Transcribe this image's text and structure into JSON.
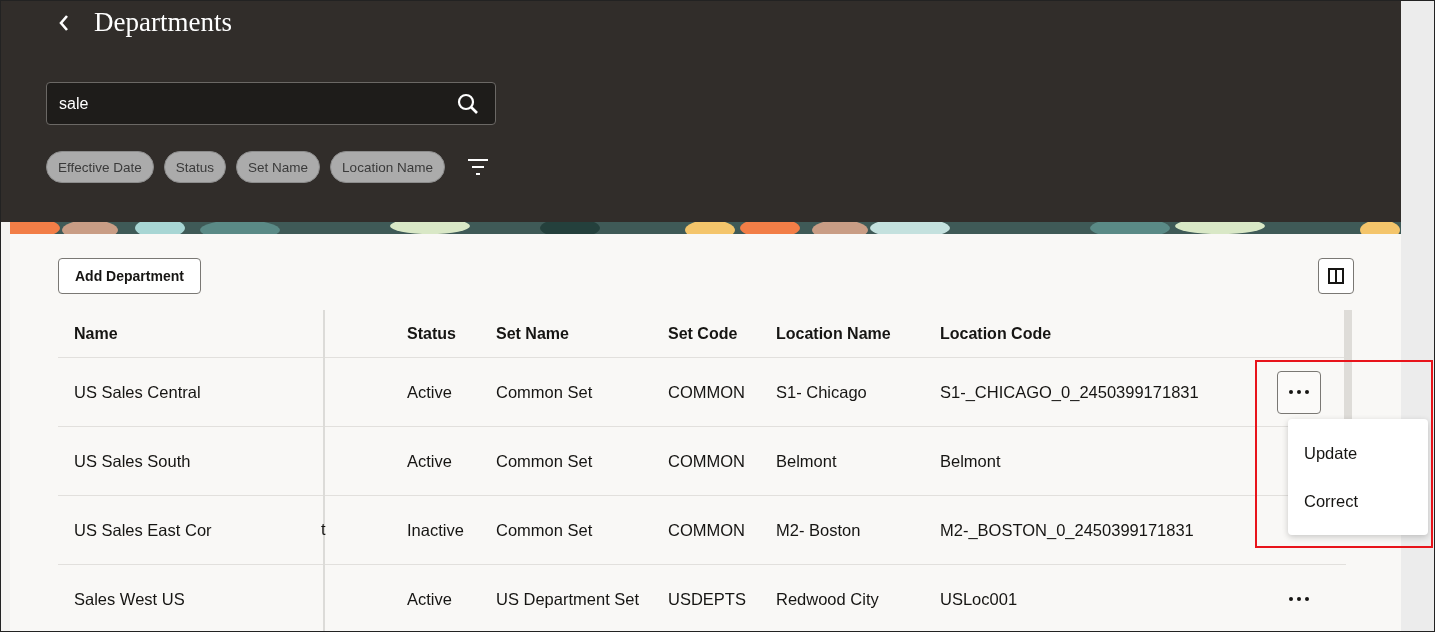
{
  "header": {
    "title": "Departments"
  },
  "search": {
    "value": "sale"
  },
  "filters": [
    {
      "label": "Effective Date"
    },
    {
      "label": "Status"
    },
    {
      "label": "Set Name"
    },
    {
      "label": "Location Name"
    }
  ],
  "toolbar": {
    "add_button": "Add Department"
  },
  "table": {
    "columns": [
      "Name",
      "Status",
      "Set Name",
      "Set Code",
      "Location Name",
      "Location Code"
    ],
    "rows": [
      {
        "name": "US Sales Central",
        "status": "Active",
        "set_name": "Common Set",
        "set_code": "COMMON",
        "location_name": "S1- Chicago",
        "location_code": "S1-_CHICAGO_0_2450399171831",
        "menu_open": true
      },
      {
        "name": "US Sales South",
        "status": "Active",
        "set_name": "Common Set",
        "set_code": "COMMON",
        "location_name": "Belmont",
        "location_code": "Belmont",
        "menu_open": false
      },
      {
        "name": "US Sales East Cor",
        "column_2": "t",
        "status": "Inactive",
        "set_name": "Common Set",
        "set_code": "COMMON",
        "location_name": "M2- Boston",
        "location_code": "M2-_BOSTON_0_2450399171831",
        "menu_open": false
      },
      {
        "name": "Sales West US",
        "status": "Active",
        "set_name": "US Department Set",
        "set_code": "USDEPTS",
        "location_name": "Redwood City",
        "location_code": "USLoc001",
        "menu_open": false
      }
    ]
  },
  "row_menu": {
    "items": [
      "Update",
      "Correct"
    ]
  }
}
